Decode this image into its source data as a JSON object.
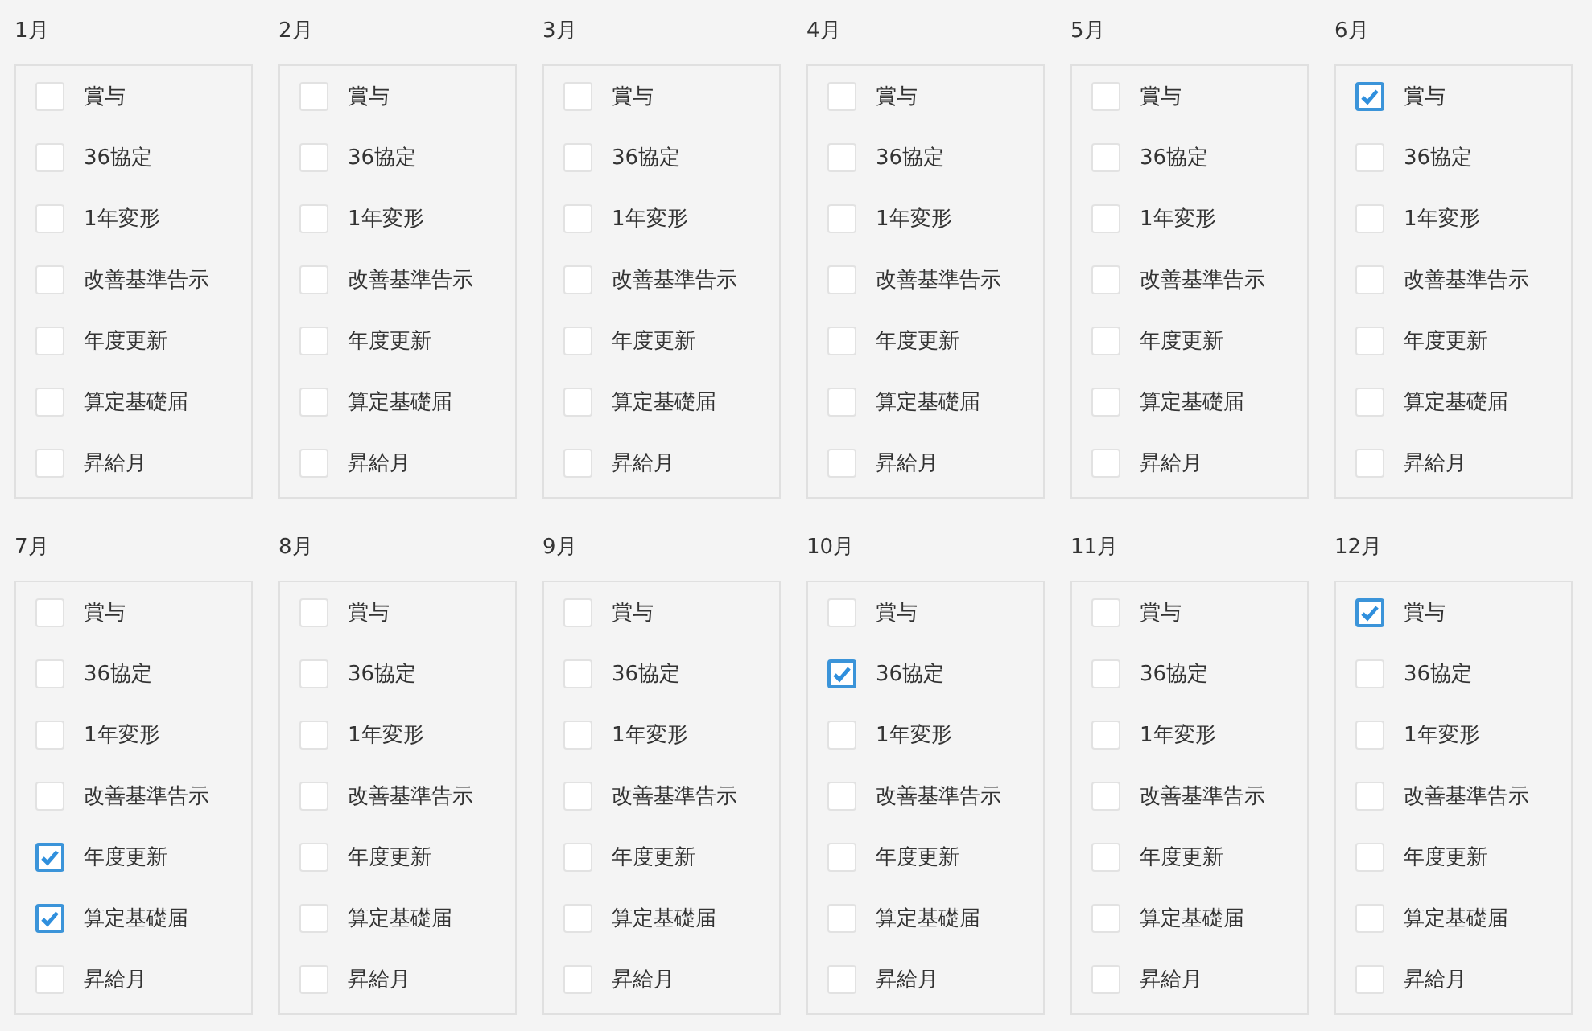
{
  "months": [
    {
      "label": "1月",
      "items": [
        {
          "label": "賞与",
          "checked": false
        },
        {
          "label": "36協定",
          "checked": false
        },
        {
          "label": "1年変形",
          "checked": false
        },
        {
          "label": "改善基準告示",
          "checked": false
        },
        {
          "label": "年度更新",
          "checked": false
        },
        {
          "label": "算定基礎届",
          "checked": false
        },
        {
          "label": "昇給月",
          "checked": false
        }
      ]
    },
    {
      "label": "2月",
      "items": [
        {
          "label": "賞与",
          "checked": false
        },
        {
          "label": "36協定",
          "checked": false
        },
        {
          "label": "1年変形",
          "checked": false
        },
        {
          "label": "改善基準告示",
          "checked": false
        },
        {
          "label": "年度更新",
          "checked": false
        },
        {
          "label": "算定基礎届",
          "checked": false
        },
        {
          "label": "昇給月",
          "checked": false
        }
      ]
    },
    {
      "label": "3月",
      "items": [
        {
          "label": "賞与",
          "checked": false
        },
        {
          "label": "36協定",
          "checked": false
        },
        {
          "label": "1年変形",
          "checked": false
        },
        {
          "label": "改善基準告示",
          "checked": false
        },
        {
          "label": "年度更新",
          "checked": false
        },
        {
          "label": "算定基礎届",
          "checked": false
        },
        {
          "label": "昇給月",
          "checked": false
        }
      ]
    },
    {
      "label": "4月",
      "items": [
        {
          "label": "賞与",
          "checked": false
        },
        {
          "label": "36協定",
          "checked": false
        },
        {
          "label": "1年変形",
          "checked": false
        },
        {
          "label": "改善基準告示",
          "checked": false
        },
        {
          "label": "年度更新",
          "checked": false
        },
        {
          "label": "算定基礎届",
          "checked": false
        },
        {
          "label": "昇給月",
          "checked": false
        }
      ]
    },
    {
      "label": "5月",
      "items": [
        {
          "label": "賞与",
          "checked": false
        },
        {
          "label": "36協定",
          "checked": false
        },
        {
          "label": "1年変形",
          "checked": false
        },
        {
          "label": "改善基準告示",
          "checked": false
        },
        {
          "label": "年度更新",
          "checked": false
        },
        {
          "label": "算定基礎届",
          "checked": false
        },
        {
          "label": "昇給月",
          "checked": false
        }
      ]
    },
    {
      "label": "6月",
      "items": [
        {
          "label": "賞与",
          "checked": true
        },
        {
          "label": "36協定",
          "checked": false
        },
        {
          "label": "1年変形",
          "checked": false
        },
        {
          "label": "改善基準告示",
          "checked": false
        },
        {
          "label": "年度更新",
          "checked": false
        },
        {
          "label": "算定基礎届",
          "checked": false
        },
        {
          "label": "昇給月",
          "checked": false
        }
      ]
    },
    {
      "label": "7月",
      "items": [
        {
          "label": "賞与",
          "checked": false
        },
        {
          "label": "36協定",
          "checked": false
        },
        {
          "label": "1年変形",
          "checked": false
        },
        {
          "label": "改善基準告示",
          "checked": false
        },
        {
          "label": "年度更新",
          "checked": true
        },
        {
          "label": "算定基礎届",
          "checked": true
        },
        {
          "label": "昇給月",
          "checked": false
        }
      ]
    },
    {
      "label": "8月",
      "items": [
        {
          "label": "賞与",
          "checked": false
        },
        {
          "label": "36協定",
          "checked": false
        },
        {
          "label": "1年変形",
          "checked": false
        },
        {
          "label": "改善基準告示",
          "checked": false
        },
        {
          "label": "年度更新",
          "checked": false
        },
        {
          "label": "算定基礎届",
          "checked": false
        },
        {
          "label": "昇給月",
          "checked": false
        }
      ]
    },
    {
      "label": "9月",
      "items": [
        {
          "label": "賞与",
          "checked": false
        },
        {
          "label": "36協定",
          "checked": false
        },
        {
          "label": "1年変形",
          "checked": false
        },
        {
          "label": "改善基準告示",
          "checked": false
        },
        {
          "label": "年度更新",
          "checked": false
        },
        {
          "label": "算定基礎届",
          "checked": false
        },
        {
          "label": "昇給月",
          "checked": false
        }
      ]
    },
    {
      "label": "10月",
      "items": [
        {
          "label": "賞与",
          "checked": false
        },
        {
          "label": "36協定",
          "checked": true
        },
        {
          "label": "1年変形",
          "checked": false
        },
        {
          "label": "改善基準告示",
          "checked": false
        },
        {
          "label": "年度更新",
          "checked": false
        },
        {
          "label": "算定基礎届",
          "checked": false
        },
        {
          "label": "昇給月",
          "checked": false
        }
      ]
    },
    {
      "label": "11月",
      "items": [
        {
          "label": "賞与",
          "checked": false
        },
        {
          "label": "36協定",
          "checked": false
        },
        {
          "label": "1年変形",
          "checked": false
        },
        {
          "label": "改善基準告示",
          "checked": false
        },
        {
          "label": "年度更新",
          "checked": false
        },
        {
          "label": "算定基礎届",
          "checked": false
        },
        {
          "label": "昇給月",
          "checked": false
        }
      ]
    },
    {
      "label": "12月",
      "items": [
        {
          "label": "賞与",
          "checked": true
        },
        {
          "label": "36協定",
          "checked": false
        },
        {
          "label": "1年変形",
          "checked": false
        },
        {
          "label": "改善基準告示",
          "checked": false
        },
        {
          "label": "年度更新",
          "checked": false
        },
        {
          "label": "算定基礎届",
          "checked": false
        },
        {
          "label": "昇給月",
          "checked": false
        }
      ]
    }
  ]
}
